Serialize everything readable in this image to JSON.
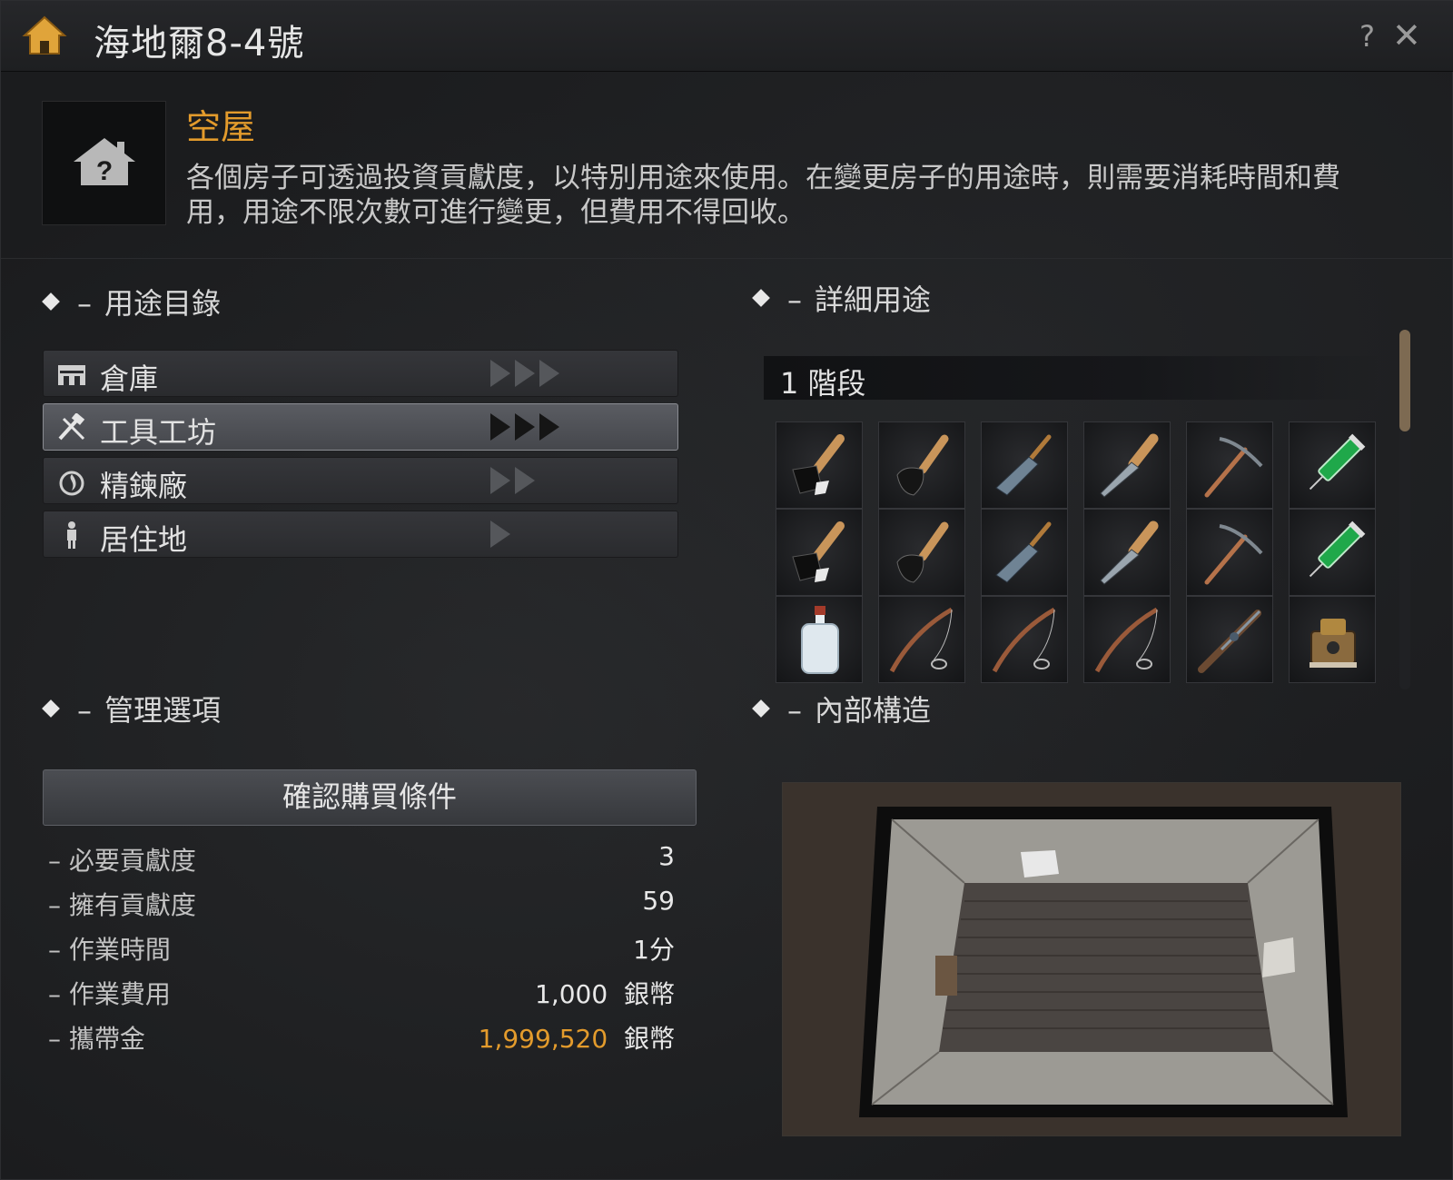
{
  "window": {
    "title": "海地爾8-4號",
    "help_icon": "question-icon",
    "close_icon": "close-icon"
  },
  "header": {
    "status": "空屋",
    "description": "各個房子可透過投資貢獻度，以特別用途來使用。在變更房子的用途時，則需要消耗時間和費用，用途不限次數可進行變更，但費用不得回收。",
    "status_color": "#e39b2c"
  },
  "usage": {
    "heading": "用途目錄",
    "items": [
      {
        "label": "倉庫",
        "icon": "warehouse-icon",
        "arrows": 3
      },
      {
        "label": "工具工坊",
        "icon": "tools-icon",
        "arrows": 3,
        "selected": true
      },
      {
        "label": "精鍊廠",
        "icon": "refinery-icon",
        "arrows": 2
      },
      {
        "label": "居住地",
        "icon": "person-icon",
        "arrows": 1
      }
    ]
  },
  "detail": {
    "heading": "詳細用途",
    "stage": "1 階段",
    "items": [
      [
        "axe-icon",
        "hoe-icon",
        "cleaver-icon",
        "knife-icon",
        "pickaxe-icon",
        "syringe-icon"
      ],
      [
        "axe-icon",
        "hoe-icon",
        "cleaver-icon",
        "knife-icon",
        "pickaxe-icon",
        "syringe-icon"
      ],
      [
        "bottle-icon",
        "fishing-rod-icon",
        "fishing-rod-icon",
        "fishing-rod-icon",
        "musket-icon",
        "matchlock-icon"
      ]
    ]
  },
  "management": {
    "heading": "管理選項",
    "confirm_button": "確認購買條件",
    "rows": [
      {
        "label": "必要貢獻度",
        "value": "3"
      },
      {
        "label": "擁有貢獻度",
        "value": "59"
      },
      {
        "label": "作業時間",
        "value": "1分"
      },
      {
        "label": "作業費用",
        "value": "1,000",
        "unit": "銀幣"
      },
      {
        "label": "攜帶金",
        "value": "1,999,520",
        "unit": "銀幣",
        "gold": true
      }
    ]
  },
  "interior": {
    "heading": "內部構造"
  },
  "colors": {
    "accent_orange": "#e39b2c",
    "panel_bg": "#1b1c1e"
  }
}
